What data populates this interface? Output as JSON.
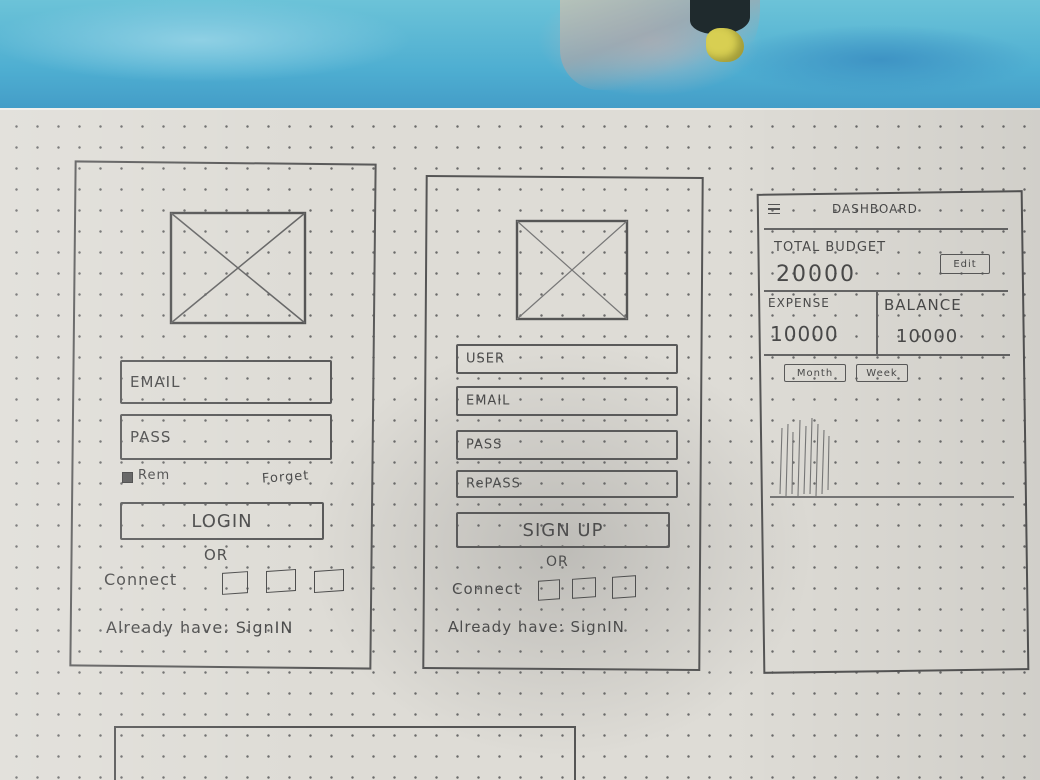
{
  "login_screen": {
    "email_label": "EMAIL",
    "pass_label": "PASS",
    "remember_label": "Rem",
    "forgot_label": "Forget",
    "login_button": "LOGIN",
    "or_label": "OR",
    "connect_label": "Connect",
    "footer_text": "Already have: SignIN"
  },
  "signup_screen": {
    "user_label": "USER",
    "email_label": "EMAIL",
    "pass_label": "PASS",
    "repass_label": "RePASS",
    "signup_button": "SIGN UP",
    "or_label": "OR",
    "connect_label": "Connect",
    "footer_text": "Already have: SignIN"
  },
  "dashboard_screen": {
    "menu_icon": "hamburger-icon",
    "title": "DASHBOARD",
    "total_budget_label": "TOTAL BUDGET",
    "total_budget_value": "20000",
    "edit_label": "Edit",
    "expense_label": "EXPENSE",
    "expense_value": "10000",
    "balance_label": "BALANCE",
    "balance_value": "10000",
    "tab_month": "Month",
    "tab_week": "Week"
  },
  "colors": {
    "paper": "#dedcd6",
    "pencil": "#555555",
    "cloth": "#4eaed1"
  }
}
